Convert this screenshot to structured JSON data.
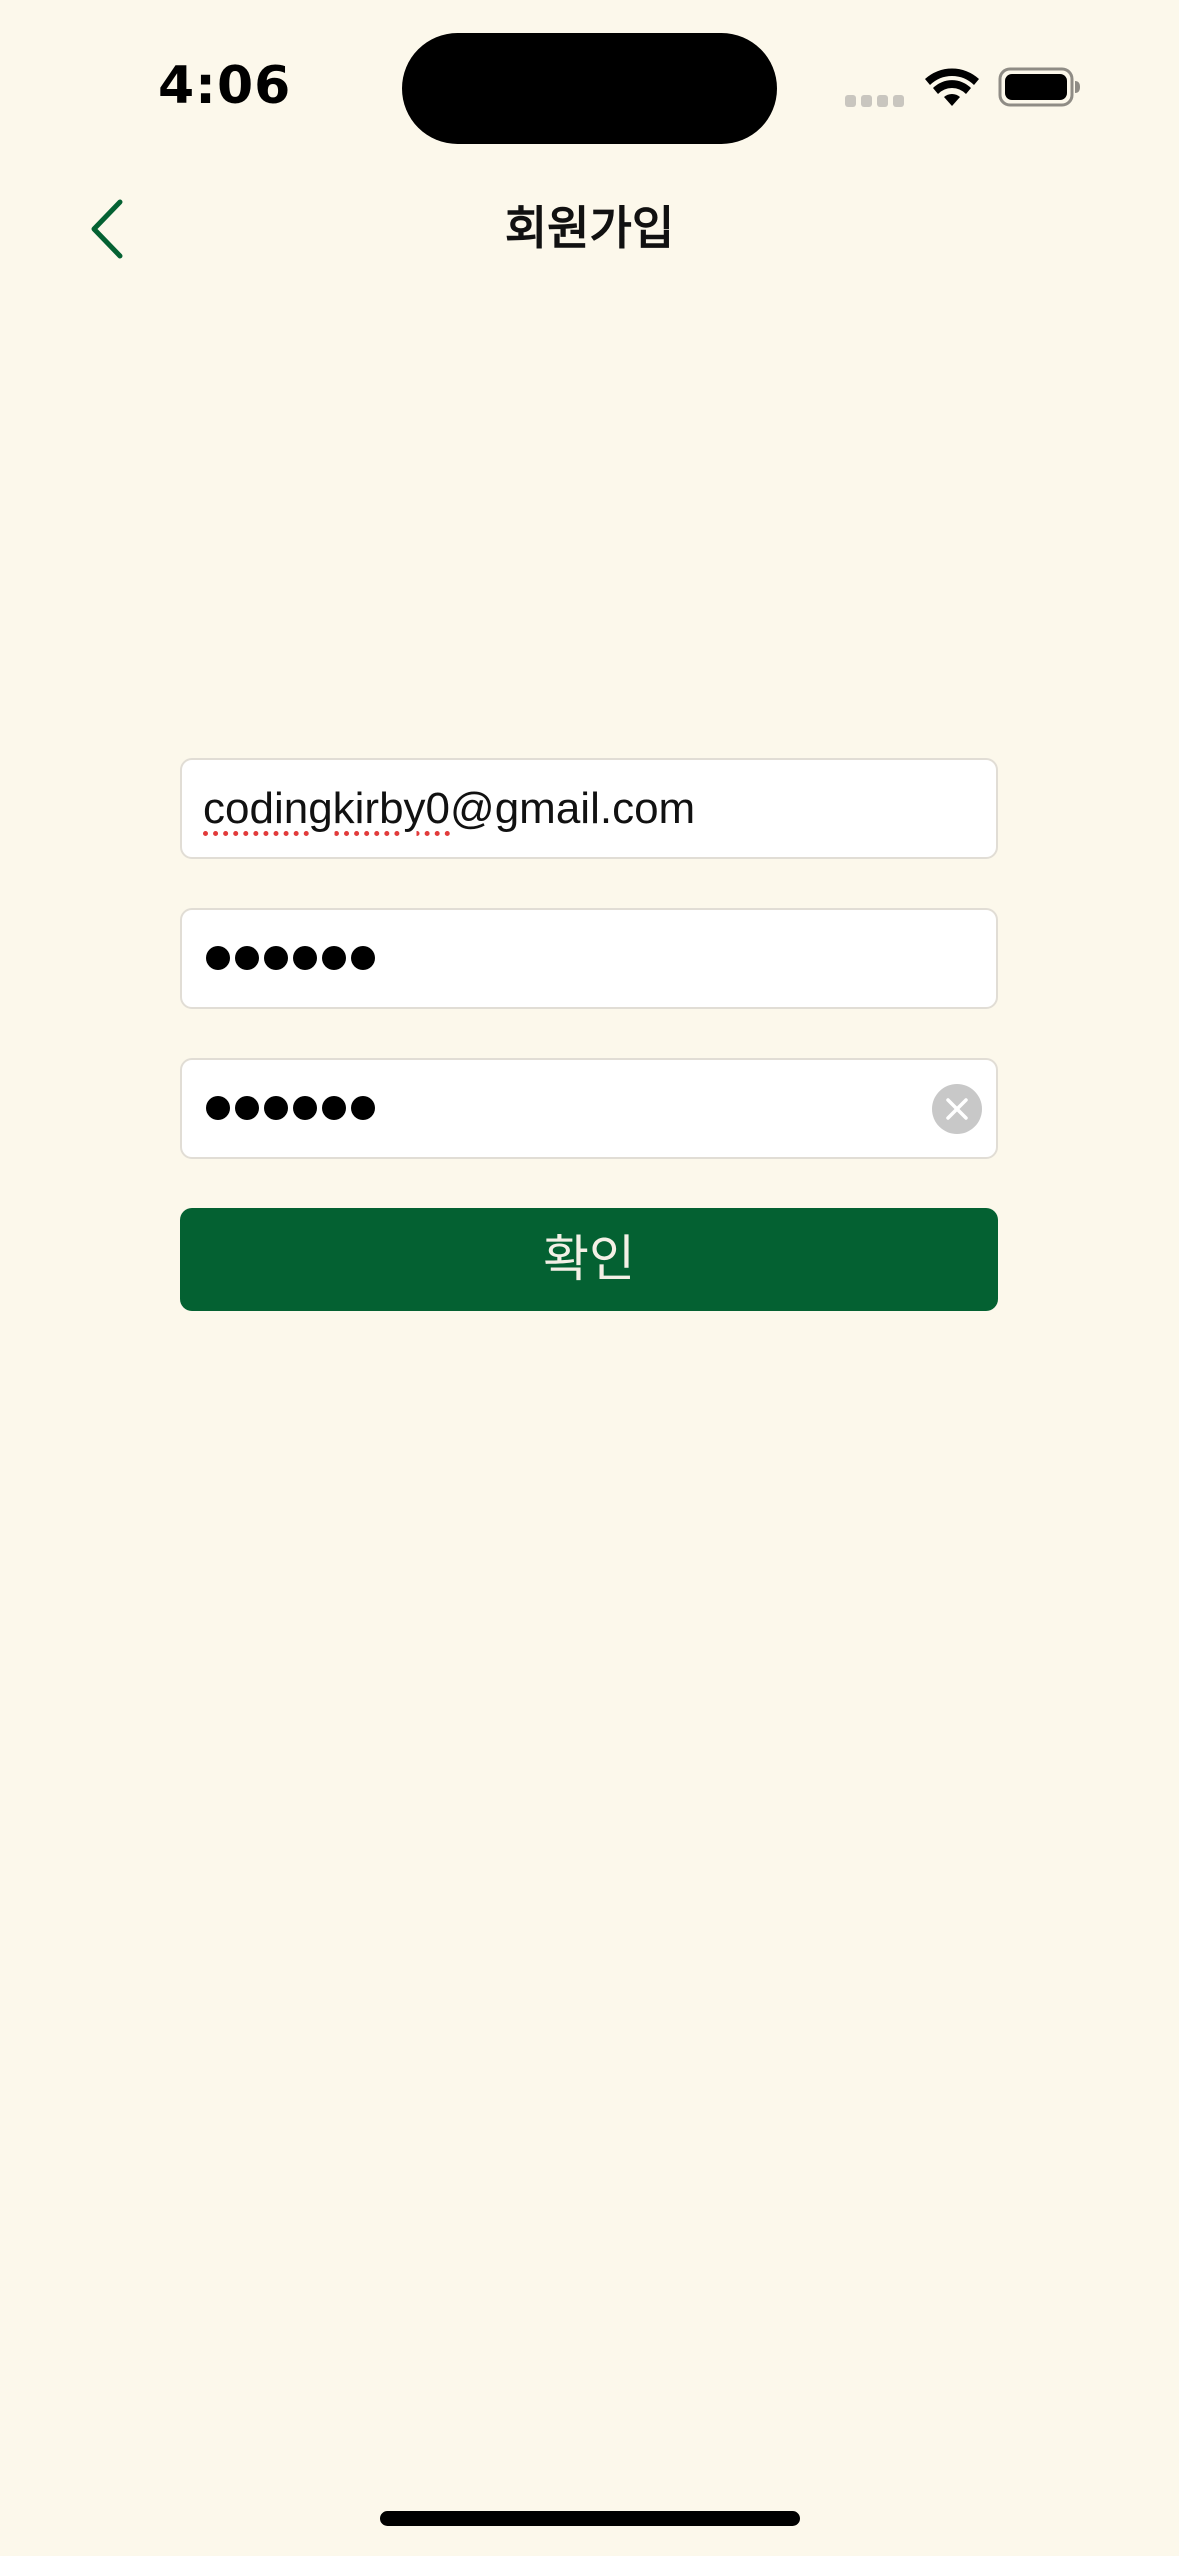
{
  "status_bar": {
    "time": "4:06",
    "icons": [
      "signal-icon",
      "wifi-icon",
      "battery-icon"
    ]
  },
  "nav": {
    "back_icon": "chevron-left-icon",
    "title": "회원가입"
  },
  "form": {
    "email": {
      "value": "codingkirby0@gmail.com",
      "misspelled_part": "codingkirby0",
      "rest": "@gmail.com"
    },
    "password": {
      "masked_length": 6
    },
    "password_confirm": {
      "masked_length": 6,
      "clear_icon": "clear-circle-icon"
    },
    "confirm_label": "확인"
  },
  "colors": {
    "background": "#fcf8eb",
    "accent": "#046132",
    "field_border": "#e1ddd5",
    "spellcheck_underline": "#e23b3b"
  }
}
